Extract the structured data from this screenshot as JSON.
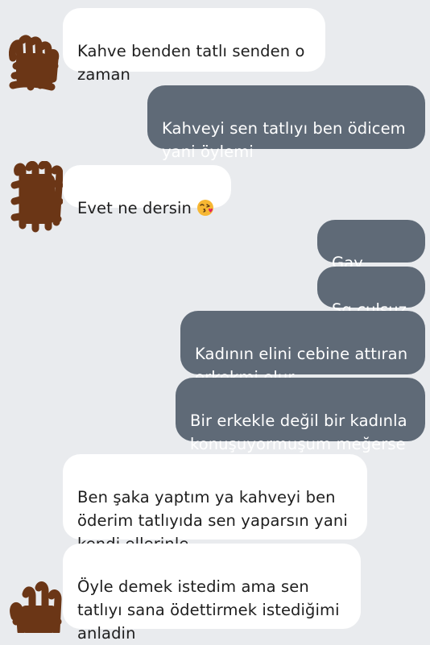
{
  "messages": [
    {
      "side": "incoming",
      "text": "Kahve benden tatlı senden o\nzaman"
    },
    {
      "side": "outgoing",
      "text": "Kahveyi sen tatlıyı ben ödicem\nyani öylemi"
    },
    {
      "side": "incoming",
      "text": "Evet ne dersin",
      "emoji": "face-blowing-kiss-emoji"
    },
    {
      "side": "outgoing",
      "text": "Gay derim"
    },
    {
      "side": "outgoing",
      "text": "Sg çulsuz"
    },
    {
      "side": "outgoing",
      "text": "Kadının elini cebine attıran\nerkekmi olur"
    },
    {
      "side": "outgoing",
      "text": "Bir erkekle değil bir kadınla\nkonuşuyormuşum meğerse"
    },
    {
      "side": "incoming",
      "text": "Ben şaka yaptım ya kahveyi ben\nöderim tatlıyıda sen yaparsın yani\nkendi ellerinle."
    },
    {
      "side": "incoming",
      "text": "Öyle demek istedim ama sen\ntatlıyı sana ödettirmek istediğimi\nanladin"
    }
  ],
  "colors": {
    "background": "#e9ebee",
    "incoming_bubble": "#ffffff",
    "outgoing_bubble": "#5f6a77",
    "avatar_scribble": "#6b3616"
  },
  "avatar": {
    "icon": "redacted-avatar-scribble"
  }
}
